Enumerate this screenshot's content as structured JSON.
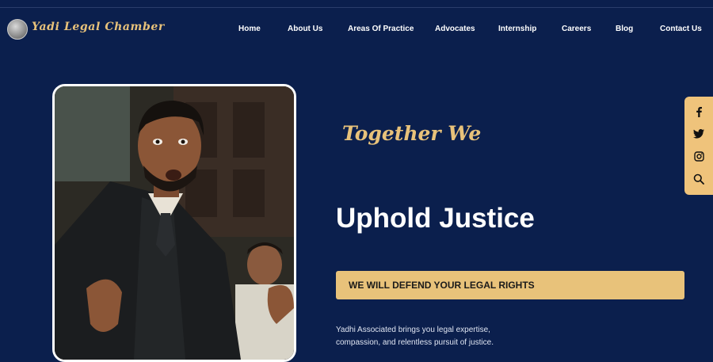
{
  "header": {
    "brand": "Yadi Legal Chamber",
    "logo_icon": "scales-logo-icon",
    "nav": [
      "Home",
      "About Us",
      "Areas Of Practice",
      "Advocates",
      "Internship",
      "Careers",
      "Blog",
      "Contact Us"
    ]
  },
  "hero": {
    "script_tagline": "Together We",
    "title": "Uphold Justice",
    "cta_label": "WE WILL DEFEND YOUR LEGAL RIGHTS",
    "description": "Yadhi Associated brings you legal expertise, compassion, and relentless pursuit of justice."
  },
  "social": [
    "facebook-icon",
    "twitter-icon",
    "instagram-icon",
    "search-icon"
  ],
  "colors": {
    "background": "#0b1f4d",
    "accent": "#e8c27a",
    "text": "#ffffff"
  }
}
